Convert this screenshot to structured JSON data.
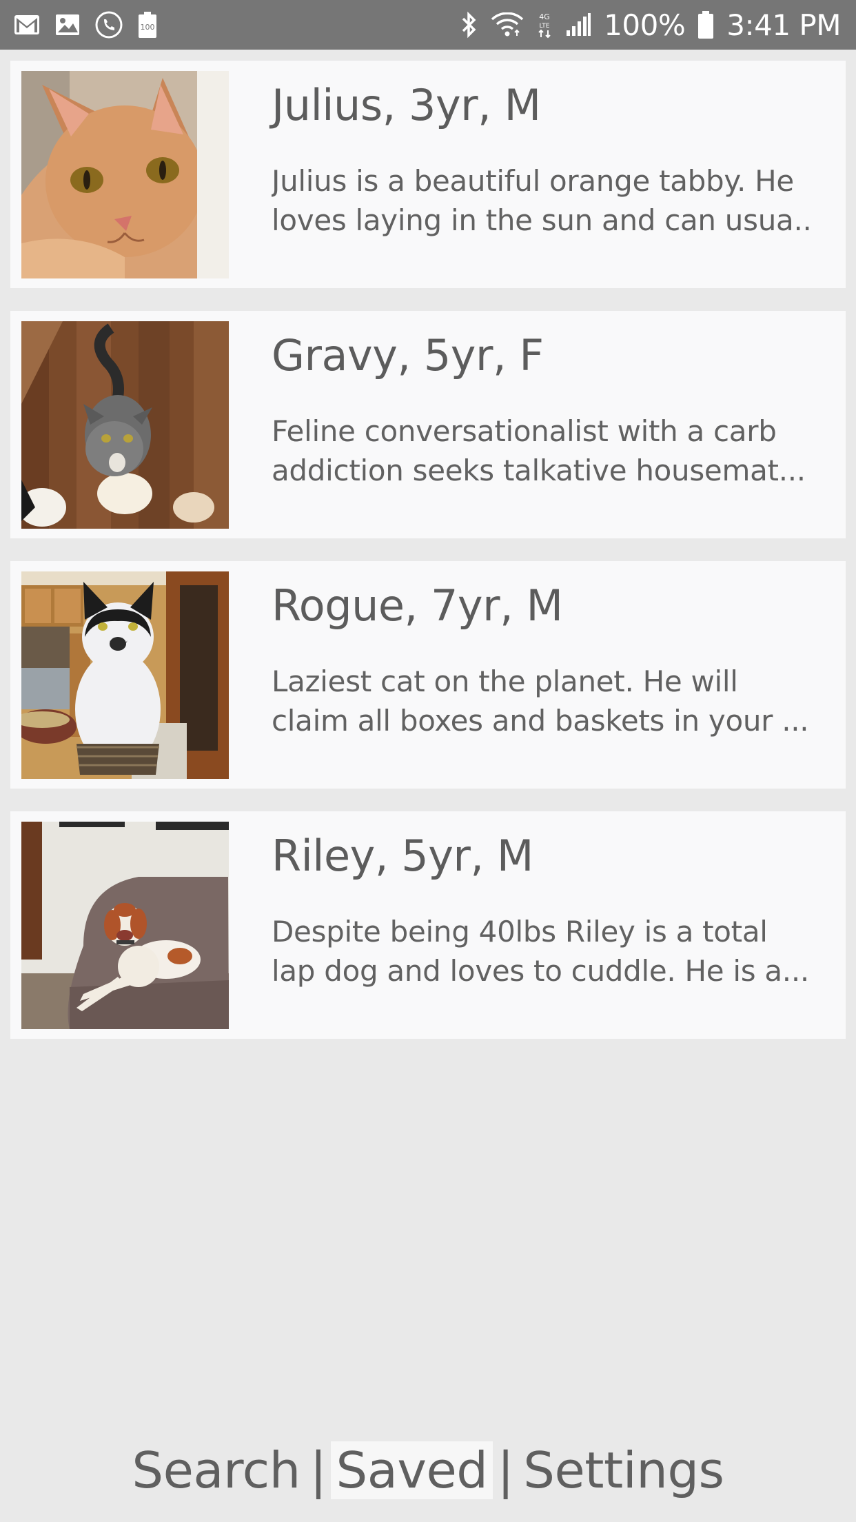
{
  "status_bar": {
    "left_icons": [
      "gmail-icon",
      "gallery-icon",
      "phone-icon",
      "battery-saver-icon"
    ],
    "battery_saver_text": "100",
    "right_icons": [
      "bluetooth-icon",
      "wifi-icon",
      "lte-icon",
      "signal-icon",
      "battery-icon"
    ],
    "network_label": "4G LTE",
    "battery_percent": "100%",
    "time": "3:41 PM"
  },
  "pets": [
    {
      "title": "Julius, 3yr, M",
      "desc_line1": "Julius is a beautiful orange tabby. He",
      "desc_line2": "loves laying in the sun and can usua..",
      "photo": "orange-tabby-cat-photo"
    },
    {
      "title": "Gravy, 5yr, F",
      "desc_line1": "Feline conversationalist with a carb",
      "desc_line2": "addiction seeks talkative housemat...",
      "photo": "gray-cat-on-wood-floor-photo"
    },
    {
      "title": "Rogue, 7yr, M",
      "desc_line1": "Laziest cat on the planet. He will",
      "desc_line2": "claim all boxes and baskets in your ...",
      "photo": "black-white-cat-in-kitchen-photo"
    },
    {
      "title": "Riley, 5yr, M",
      "desc_line1": "Despite being 40lbs Riley is a total",
      "desc_line2": "lap dog and loves to cuddle. He is a...",
      "photo": "brown-white-dog-on-couch-photo"
    }
  ],
  "nav": {
    "search": "Search",
    "sep": "|",
    "saved": "Saved",
    "settings": "Settings",
    "active": "saved"
  }
}
